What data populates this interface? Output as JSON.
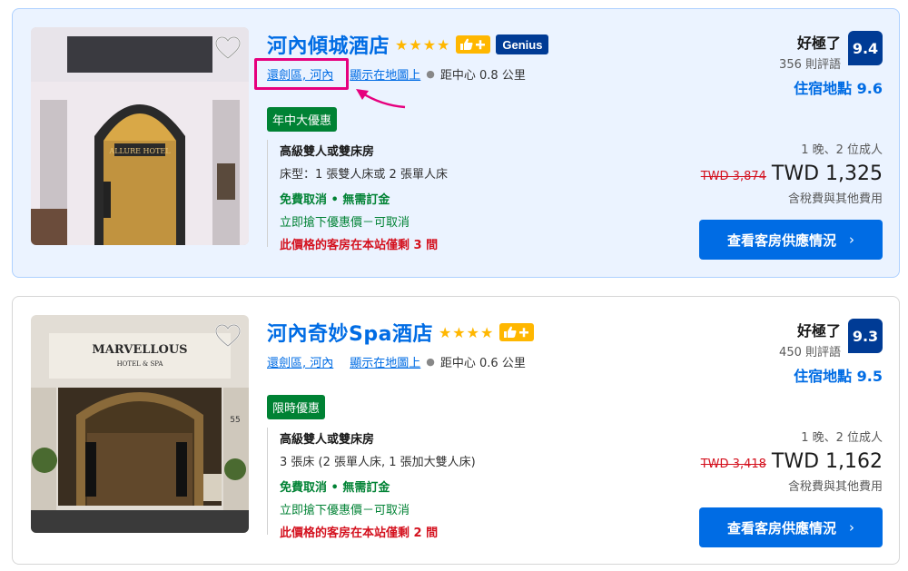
{
  "hotels": [
    {
      "name": "河內傾城酒店",
      "stars": "★★★★",
      "has_genius": true,
      "genius_label": "Genius",
      "district": "還劍區, 河內",
      "map_link": "顯示在地圖上",
      "distance": "距中心 0.8 公里",
      "deal": "年中大優惠",
      "room_type": "高級雙人或雙床房",
      "bed_info": "床型：1 張雙人床或 2 張單人床",
      "free_cancel": "免費取消 • 無需訂金",
      "grab_deal": "立即搶下優惠價－可取消",
      "scarcity": "此價格的客房在本站僅剩 3 間",
      "review_word": "好極了",
      "review_count": "356 則評語",
      "score": "9.4",
      "location_score": "住宿地點 9.6",
      "nights_guests": "1 晚、2 位成人",
      "old_price": "TWD 3,874",
      "new_price": "TWD 1,325",
      "tax_note": "含稅費與其他費用",
      "cta": "查看客房供應情況"
    },
    {
      "name": "河內奇妙Spa酒店",
      "stars": "★★★★",
      "has_genius": false,
      "district": "還劍區, 河內",
      "map_link": "顯示在地圖上",
      "distance": "距中心 0.6 公里",
      "deal": "限時優惠",
      "room_type": "高級雙人或雙床房",
      "bed_info": "3 張床 (2 張單人床, 1 張加大雙人床)",
      "free_cancel": "免費取消 • 無需訂金",
      "grab_deal": "立即搶下優惠價－可取消",
      "scarcity": "此價格的客房在本站僅剩 2 間",
      "review_word": "好極了",
      "review_count": "450 則評語",
      "score": "9.3",
      "location_score": "住宿地點 9.5",
      "nights_guests": "1 晚、2 位成人",
      "old_price": "TWD 3,418",
      "new_price": "TWD 1,162",
      "tax_note": "含稅費與其他費用",
      "cta": "查看客房供應情況"
    }
  ],
  "photo_texts": {
    "hotel1_sign": "ALLURE HOTEL",
    "hotel2_sign": "MARVELLOUS",
    "hotel2_sub": "HOTEL & SPA",
    "hotel2_number": "55"
  },
  "colors": {
    "brand_blue": "#006ce4",
    "dark_blue": "#003b95",
    "deal_green": "#008234",
    "star_yellow": "#ffb700",
    "alert_red": "#d4111e",
    "highlight_pink": "#e6007e"
  }
}
